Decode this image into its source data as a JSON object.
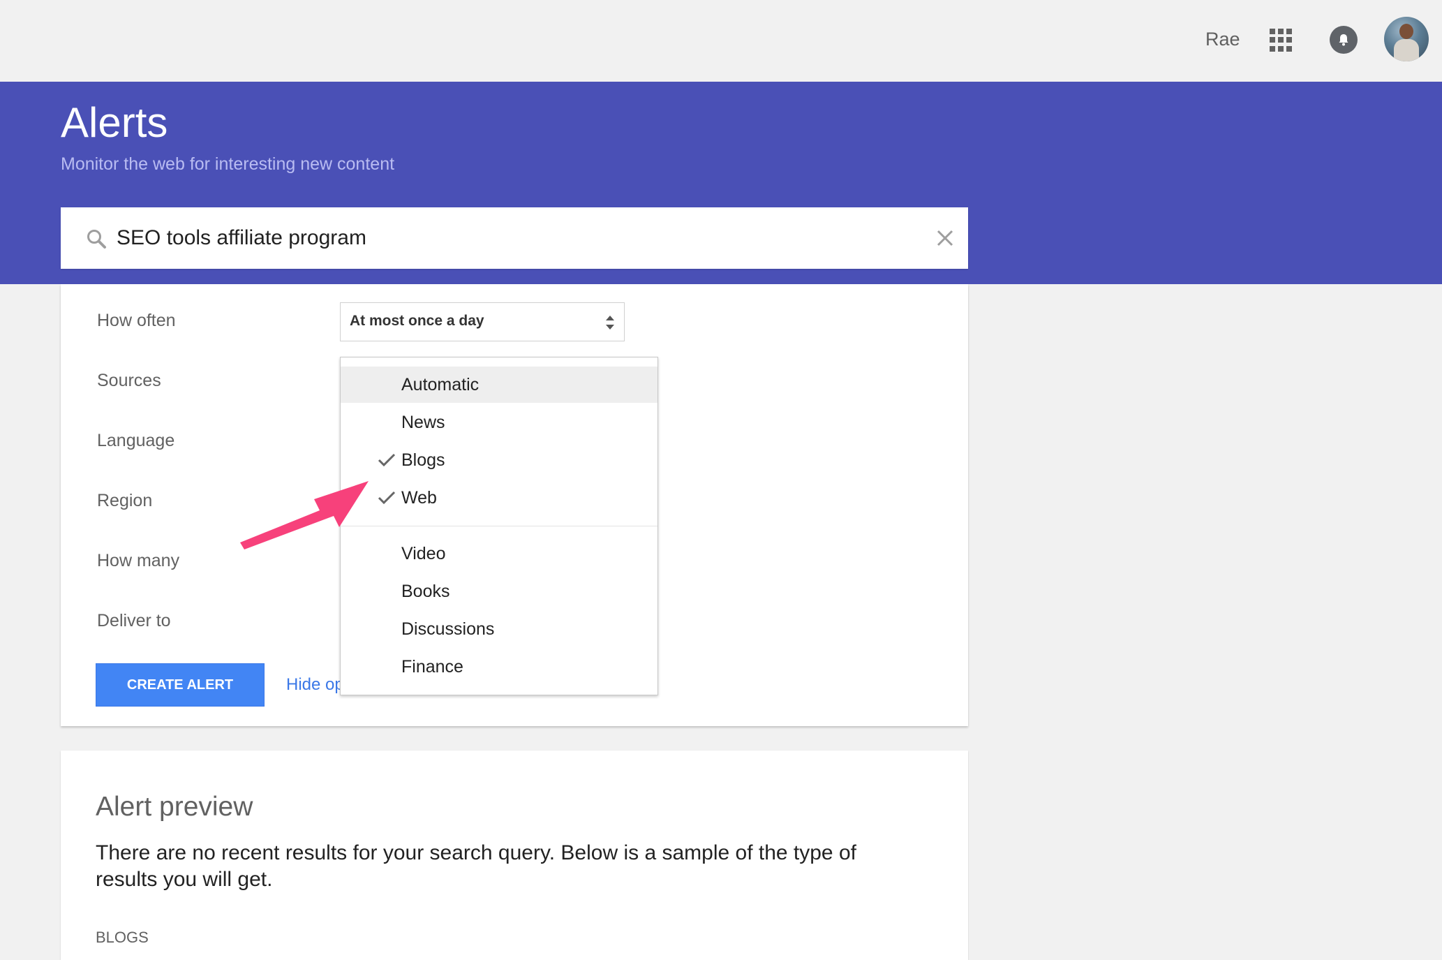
{
  "topbar": {
    "user_name": "Rae",
    "apps_icon": "apps-grid-icon",
    "notifications_icon": "bell-icon"
  },
  "header": {
    "title": "Alerts",
    "subtitle": "Monitor the web for interesting new content",
    "background_color": "#4a50b6"
  },
  "search": {
    "value": "SEO tools affiliate program",
    "icon": "search-icon",
    "clear_icon": "close-icon"
  },
  "options": {
    "labels": {
      "how_often": "How often",
      "sources": "Sources",
      "language": "Language",
      "region": "Region",
      "how_many": "How many",
      "deliver_to": "Deliver to"
    },
    "how_often_value": "At most once a day",
    "create_button": "CREATE ALERT",
    "hide_link": "Hide op"
  },
  "sources_dropdown": {
    "items": [
      {
        "label": "Automatic",
        "checked": false,
        "highlighted": true
      },
      {
        "label": "News",
        "checked": false
      },
      {
        "label": "Blogs",
        "checked": true
      },
      {
        "label": "Web",
        "checked": true
      },
      {
        "label": "Video",
        "checked": false
      },
      {
        "label": "Books",
        "checked": false
      },
      {
        "label": "Discussions",
        "checked": false
      },
      {
        "label": "Finance",
        "checked": false
      }
    ]
  },
  "annotation": {
    "arrow_color": "#f7417b"
  },
  "preview": {
    "title": "Alert preview",
    "text": "There are no recent results for your search query. Below is a sample of the type of results you will get.",
    "section": "BLOGS"
  },
  "colors": {
    "accent": "#4285f4",
    "link": "#3b78e7"
  }
}
